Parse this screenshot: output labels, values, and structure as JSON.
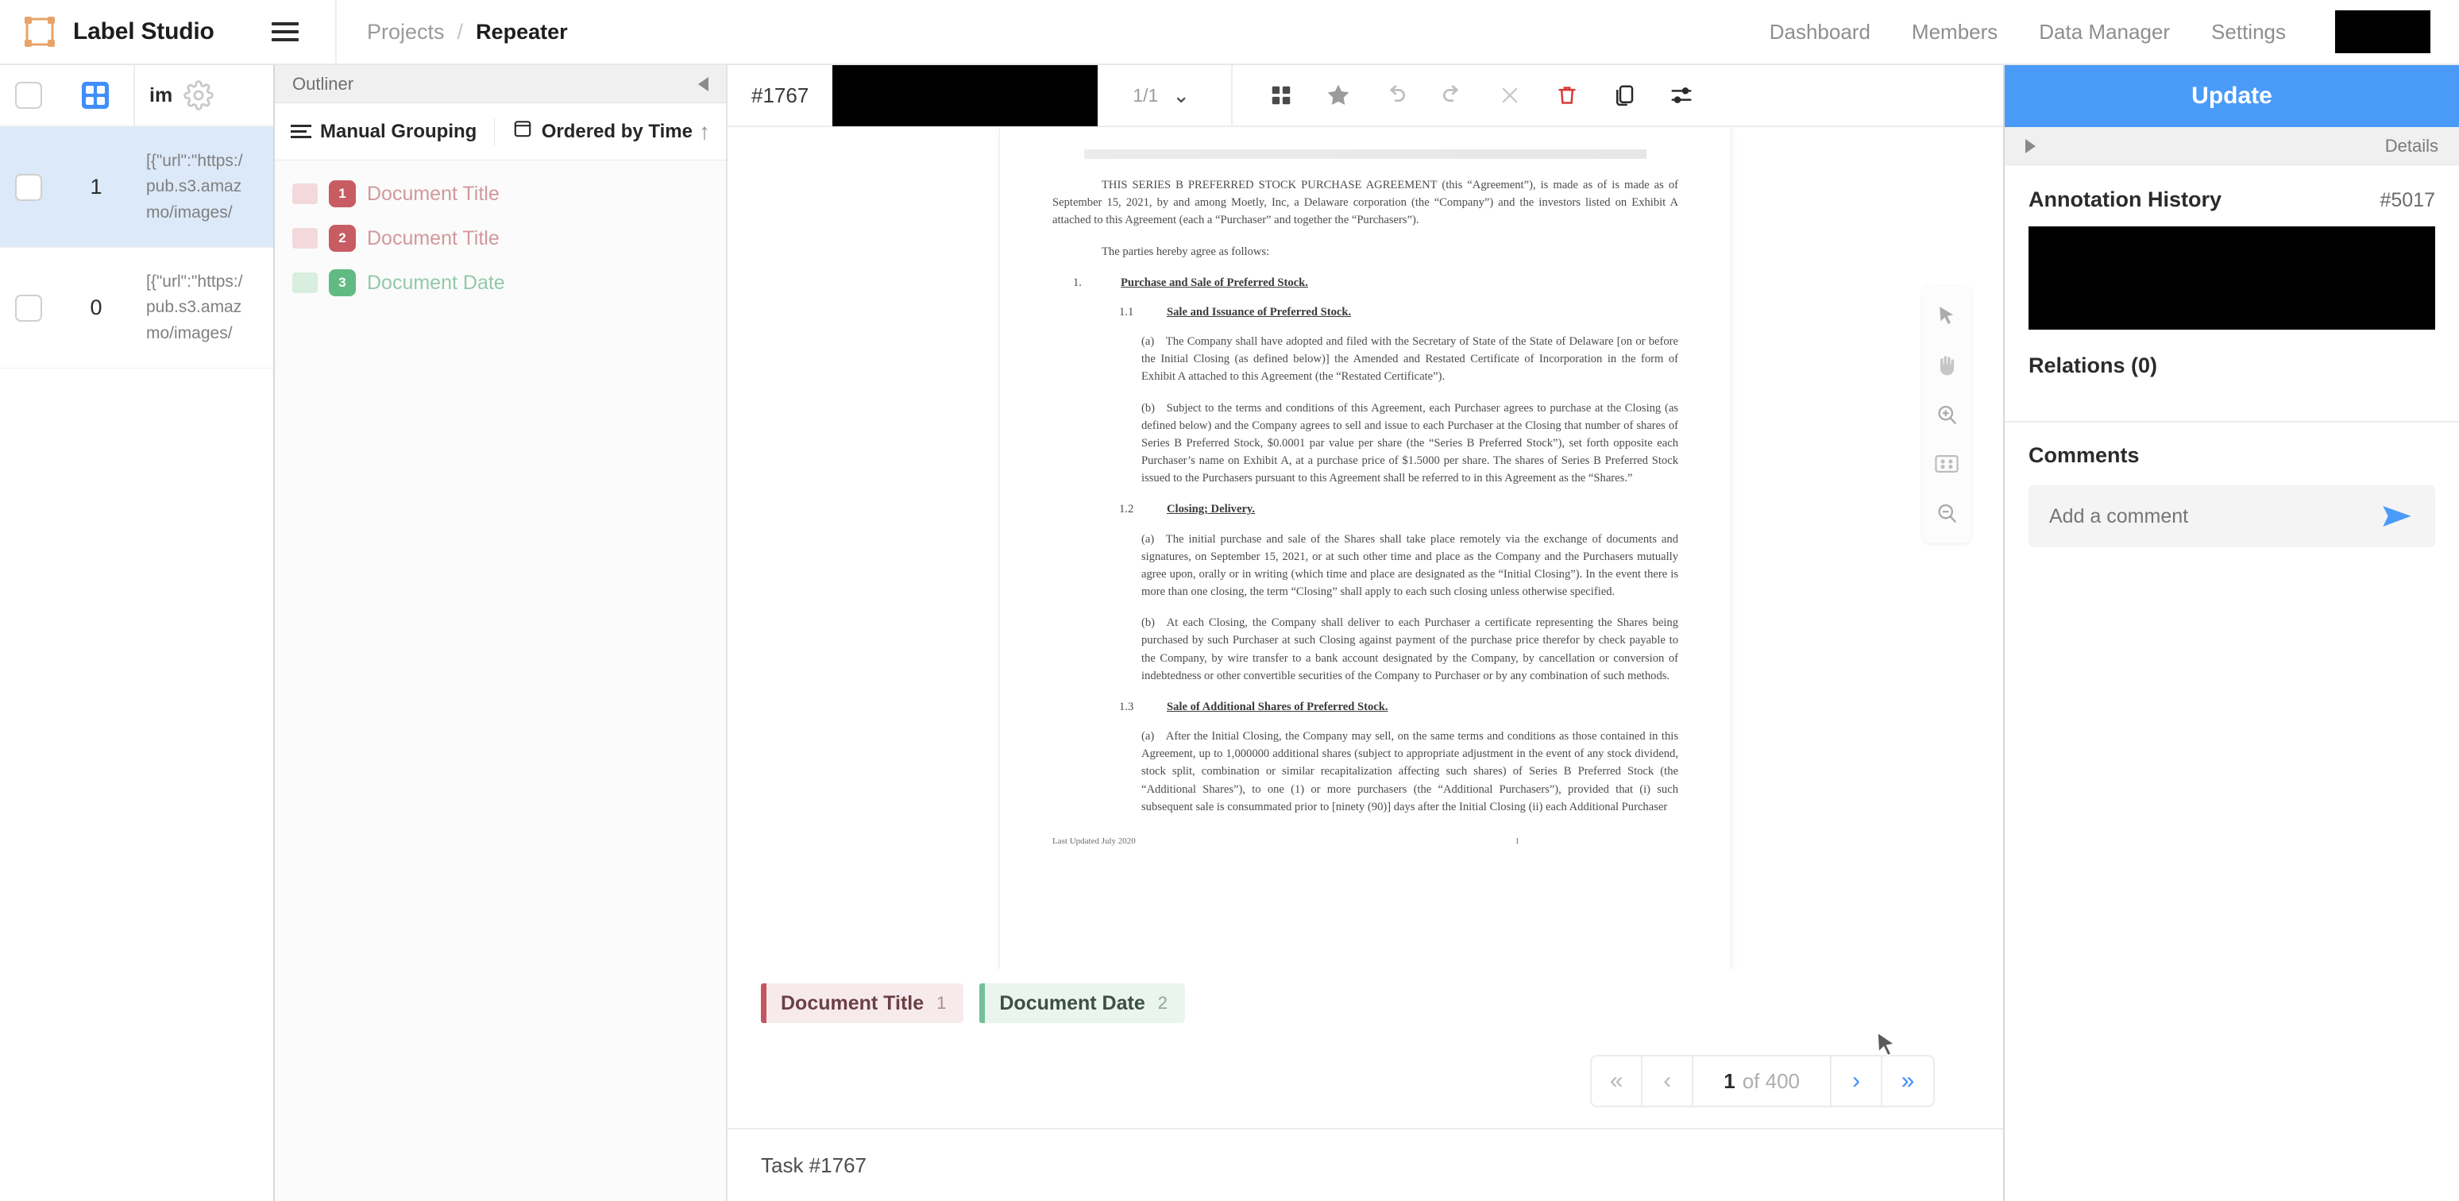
{
  "header": {
    "brand": "Label Studio",
    "breadcrumb": {
      "parent": "Projects",
      "separator": "/",
      "current": "Repeater"
    },
    "nav": [
      {
        "label": "Dashboard"
      },
      {
        "label": "Members"
      },
      {
        "label": "Data Manager"
      },
      {
        "label": "Settings"
      }
    ]
  },
  "data_manager": {
    "columns": {
      "id_icon": "grid-icon",
      "image_col": "im",
      "settings_icon": "gear-icon"
    },
    "rows": [
      {
        "id": "1",
        "selected": true,
        "data_lines": [
          "[{\"url\":\"https:/",
          "pub.s3.amaz",
          "mo/images/"
        ]
      },
      {
        "id": "0",
        "selected": false,
        "data_lines": [
          "[{\"url\":\"https:/",
          "pub.s3.amaz",
          "mo/images/"
        ]
      }
    ]
  },
  "outliner": {
    "title": "Outliner",
    "grouping_label": "Manual Grouping",
    "ordering_label": "Ordered by Time",
    "sort_direction": "↑",
    "regions": [
      {
        "index": "1",
        "label": "Document Title",
        "color": "#c75c63"
      },
      {
        "index": "2",
        "label": "Document Title",
        "color": "#c75c63"
      },
      {
        "index": "3",
        "label": "Document Date",
        "color": "#62ba83"
      }
    ]
  },
  "toolbar": {
    "task_id": "#1767",
    "annotation_count": "1/1",
    "chevron": "⌄",
    "icons": [
      {
        "name": "grid-view-icon"
      },
      {
        "name": "star-icon"
      },
      {
        "name": "undo-icon"
      },
      {
        "name": "redo-icon"
      },
      {
        "name": "reset-icon"
      },
      {
        "name": "delete-icon"
      },
      {
        "name": "copy-icon"
      },
      {
        "name": "settings-sliders-icon"
      }
    ]
  },
  "document": {
    "ghost_line": "",
    "paragraphs": [
      "THIS SERIES B PREFERRED STOCK PURCHASE AGREEMENT (this “Agreement”), is made as of is made as of September 15, 2021, by and among Moetly, Inc, a Delaware corporation (the “Company”) and the investors listed on Exhibit A attached to this Agreement (each a “Purchaser” and together the “Purchasers”).",
      "The parties hereby agree as follows:"
    ],
    "section_1": {
      "number": "1.",
      "title": "Purchase and Sale of Preferred Stock."
    },
    "section_1_1": {
      "number": "1.1",
      "title": "Sale and Issuance of Preferred Stock."
    },
    "section_1_1_a": "(a) The Company shall have adopted and filed with the Secretary of State of the State of Delaware [on or before the Initial Closing (as defined below)] the Amended and Restated Certificate of Incorporation in the form of Exhibit A attached to this Agreement (the “Restated Certificate”).",
    "section_1_1_b": "(b) Subject to the terms and conditions of this Agreement, each Purchaser agrees to purchase at the Closing (as defined below) and the Company agrees to sell and issue to each Purchaser at the Closing that number of shares of Series B Preferred Stock, $0.0001 par value per share (the “Series B Preferred Stock”), set forth opposite each Purchaser’s name on Exhibit A, at a purchase price of $1.5000 per share. The shares of Series B Preferred Stock issued to the Purchasers pursuant to this Agreement shall be referred to in this Agreement as the “Shares.”",
    "section_1_2": {
      "number": "1.2",
      "title": "Closing; Delivery."
    },
    "section_1_2_a": "(a) The initial purchase and sale of the Shares shall take place remotely via the exchange of documents and signatures, on September 15, 2021, or at such other time and place as the Company and the Purchasers mutually agree upon, orally or in writing (which time and place are designated as the “Initial Closing”). In the event there is more than one closing, the term “Closing” shall apply to each such closing unless otherwise specified.",
    "section_1_2_b": "(b) At each Closing, the Company shall deliver to each Purchaser a certificate representing the Shares being purchased by such Purchaser at such Closing against payment of the purchase price therefor by check payable to the Company, by wire transfer to a bank account designated by the Company, by cancellation or conversion of indebtedness or other convertible securities of the Company to Purchaser or by any combination of such methods.",
    "section_1_3": {
      "number": "1.3",
      "title": "Sale of Additional Shares of Preferred Stock."
    },
    "section_1_3_a": "(a) After the Initial Closing, the Company may sell, on the same terms and conditions as those contained in this Agreement, up to 1,000000 additional shares (subject to appropriate adjustment in the event of any stock dividend, stock split, combination or similar recapitalization affecting such shares) of Series B Preferred Stock (the “Additional Shares”), to one (1) or more purchasers (the “Additional Purchasers”), provided that (i) such subsequent sale is consummated prior to [ninety (90)] days after the Initial Closing (ii) each Additional Purchaser",
    "footer_left": "Last Updated July 2020",
    "footer_page": "1"
  },
  "canvas_tools": [
    {
      "name": "pointer-tool-icon"
    },
    {
      "name": "pan-hand-tool-icon"
    },
    {
      "name": "zoom-in-tool-icon"
    },
    {
      "name": "fit-to-screen-tool-icon"
    },
    {
      "name": "zoom-out-tool-icon"
    }
  ],
  "labels": [
    {
      "text": "Document Title",
      "hotkey": "1",
      "color": "#c4565f",
      "bg": "#f7eaec",
      "fg": "#6b4045"
    },
    {
      "text": "Document Date",
      "hotkey": "2",
      "color": "#72c295",
      "bg": "#e9f5ee",
      "fg": "#46634f"
    }
  ],
  "pager": {
    "first": "«",
    "prev": "‹",
    "current": "1",
    "of": "of 400",
    "next": "›",
    "last": "»"
  },
  "task_footer": {
    "label": "Task #1767"
  },
  "right_panel": {
    "update_label": "Update",
    "details_label": "Details",
    "annotation_history": {
      "title": "Annotation History",
      "id": "#5017"
    },
    "relations": {
      "title": "Relations (0)"
    },
    "comments": {
      "title": "Comments",
      "placeholder": "Add a comment"
    }
  },
  "colors": {
    "accent_blue": "#4a9bf7",
    "selected_row": "#dce9f8",
    "delete_red": "#d63a3a",
    "label_red": "#c4565f",
    "label_green": "#72c295"
  }
}
